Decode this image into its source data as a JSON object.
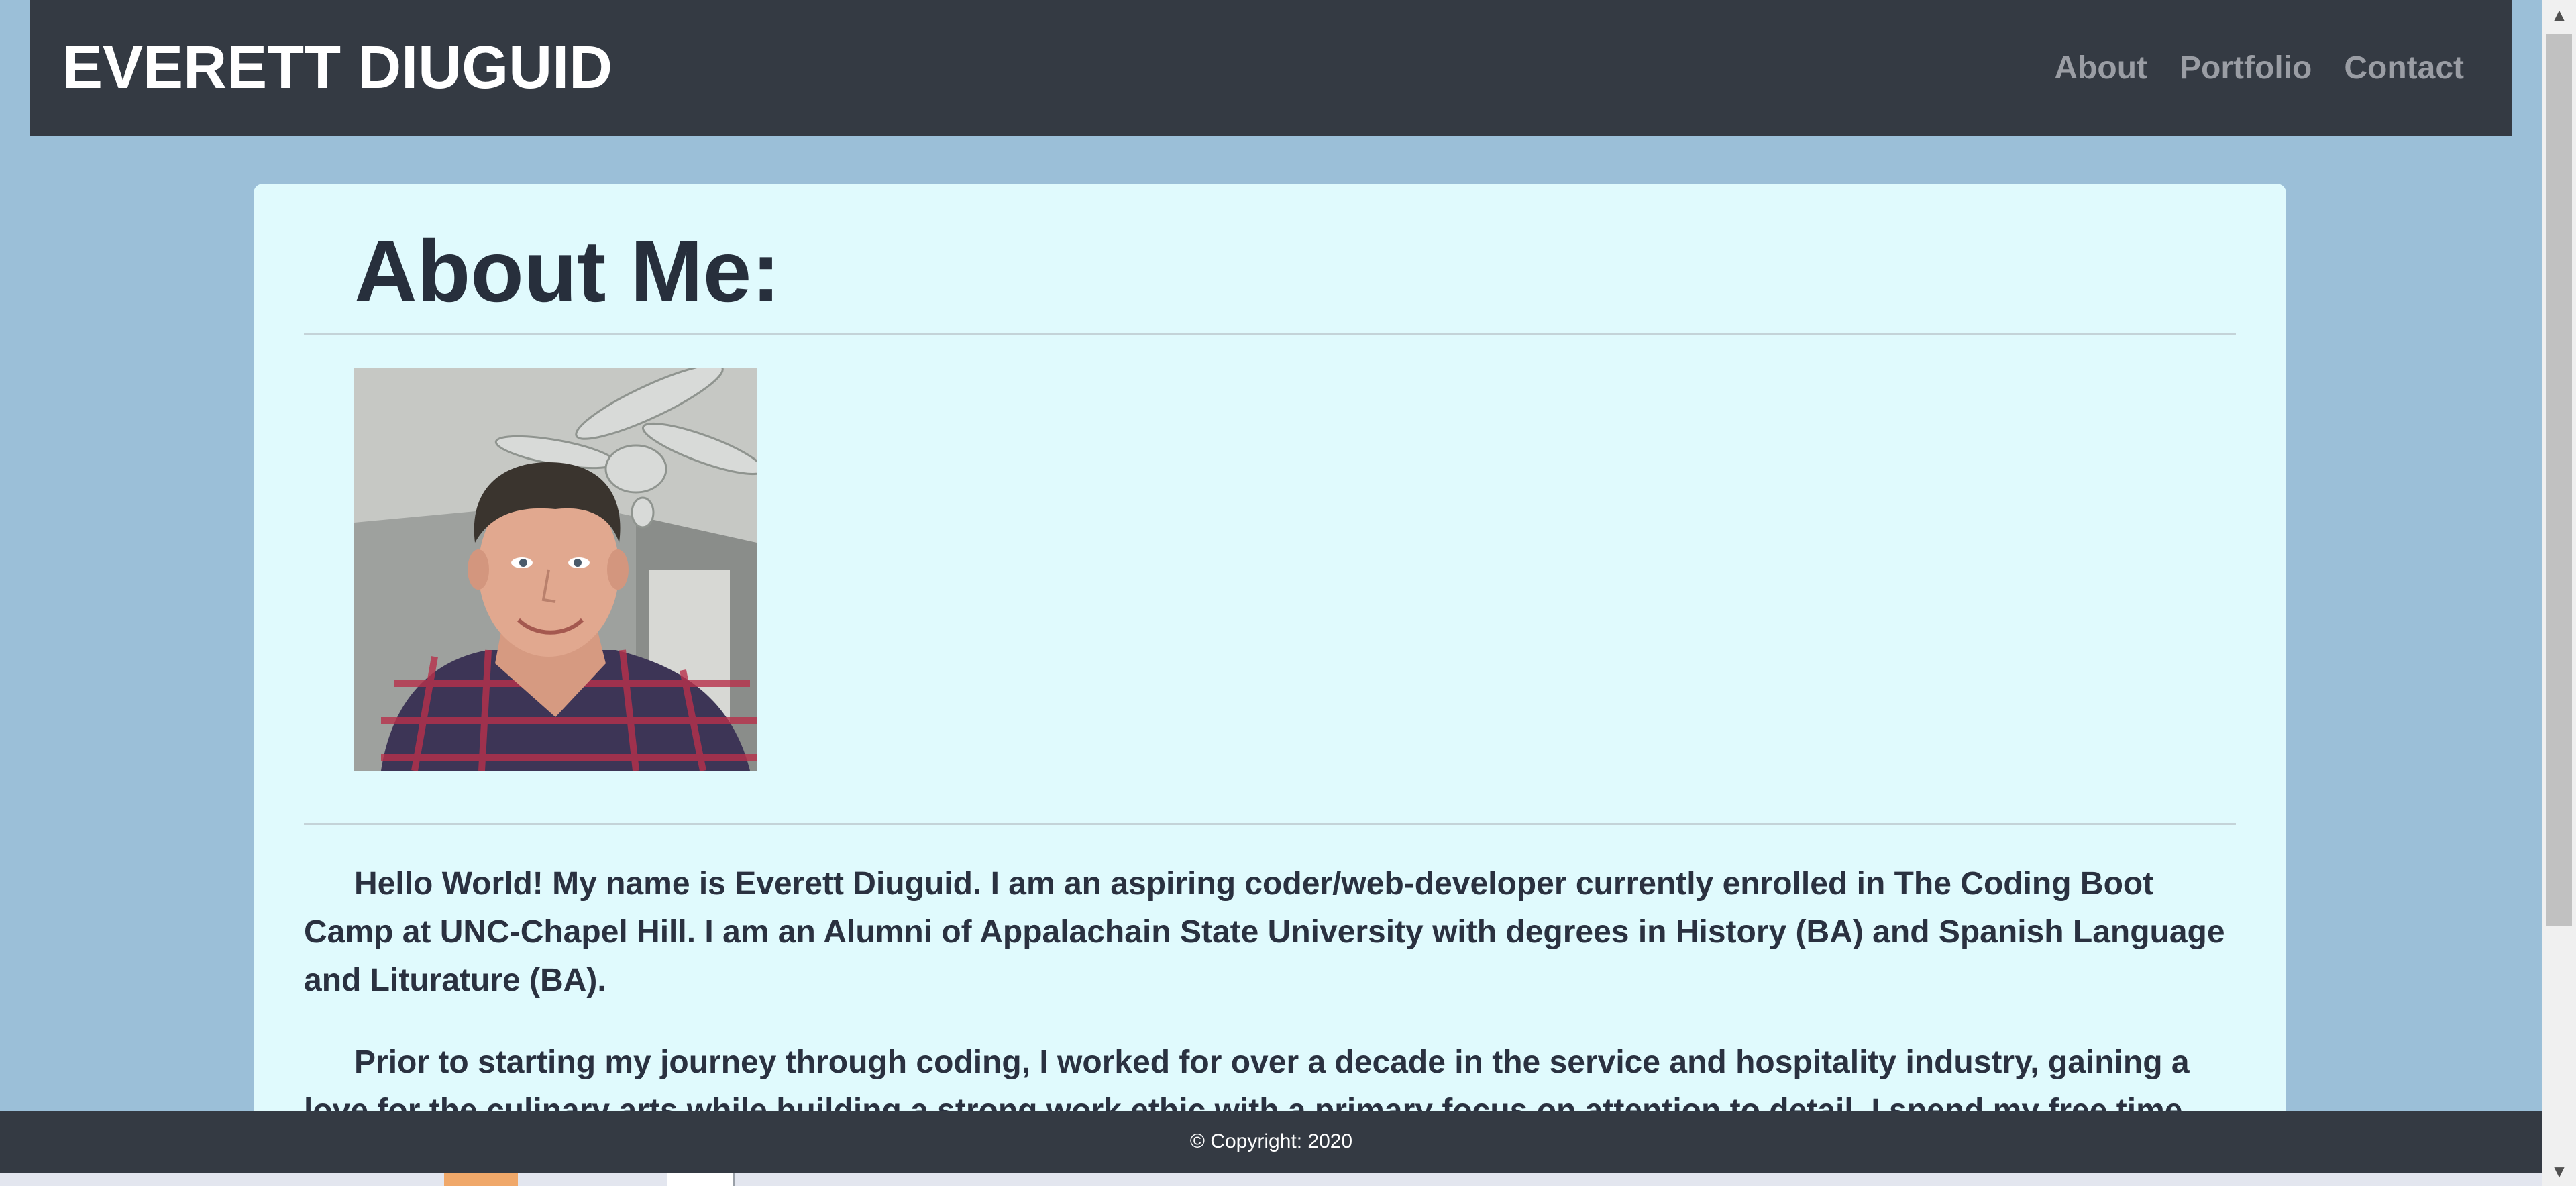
{
  "header": {
    "brand": "EVERETT DIUGUID",
    "nav": [
      {
        "label": "About"
      },
      {
        "label": "Portfolio"
      },
      {
        "label": "Contact"
      }
    ]
  },
  "main": {
    "title": "About Me:",
    "photo_icon": "profile-photo",
    "paragraphs": [
      "Hello World! My name is Everett Diuguid. I am an aspiring coder/web-developer currently enrolled in The Coding Boot Camp at UNC-Chapel Hill. I am an Alumni of Appalachain State University with degrees in History (BA) and Spanish Language and Liturature (BA).",
      "Prior to starting my journey through coding, I worked for over a decade in the service and hospitality industry, gaining a love for the culinary arts while building a strong work ethic with a primary focus on attention to detail. I spend my free time"
    ]
  },
  "footer": {
    "copyright": "© Copyright: 2020"
  },
  "scrollbar": {
    "up_icon": "scroll-up-arrow-icon",
    "down_icon": "scroll-down-arrow-icon"
  }
}
